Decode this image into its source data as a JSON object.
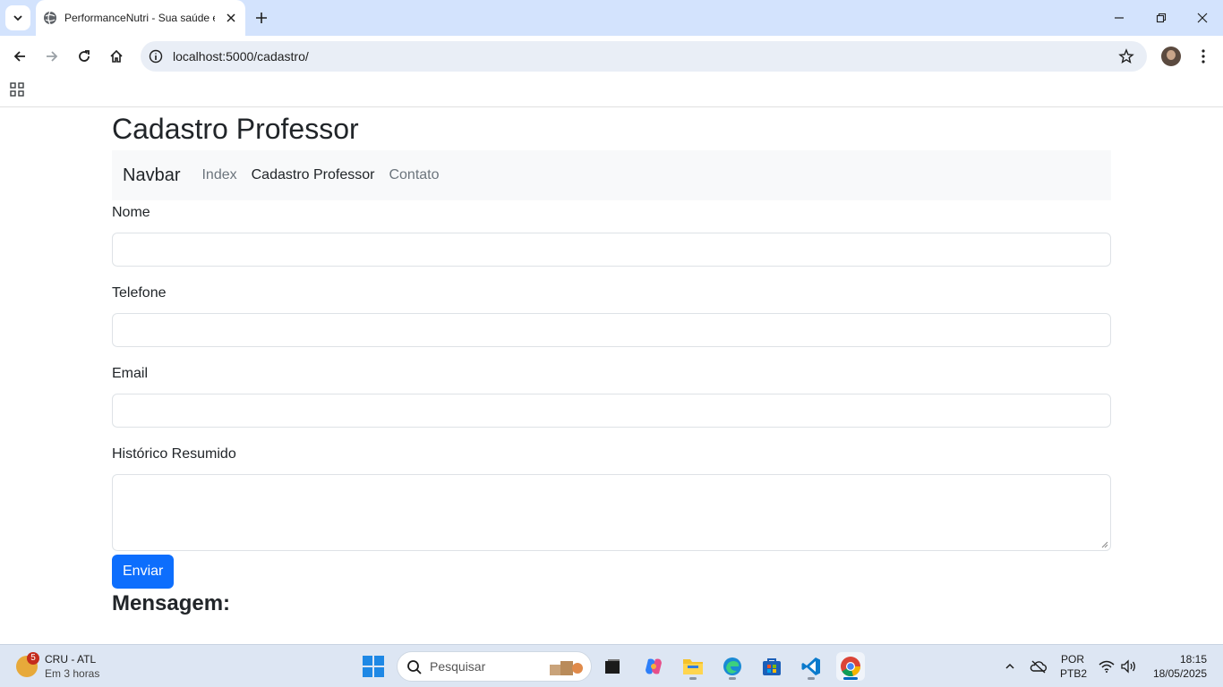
{
  "browser": {
    "tab_title": "PerformanceNutri - Sua saúde e",
    "url": "localhost:5000/cadastro/"
  },
  "page": {
    "title": "Cadastro Professor",
    "navbar": {
      "brand": "Navbar",
      "links": [
        "Index",
        "Cadastro Professor",
        "Contato"
      ],
      "active_index": 1
    },
    "form": {
      "nome_label": "Nome",
      "telefone_label": "Telefone",
      "email_label": "Email",
      "historico_label": "Histórico Resumido",
      "submit_label": "Enviar"
    },
    "message_heading": "Mensagem:"
  },
  "taskbar": {
    "weather_title": "CRU - ATL",
    "weather_sub": "Em 3 horas",
    "weather_badge": "5",
    "search_placeholder": "Pesquisar",
    "language_line1": "POR",
    "language_line2": "PTB2",
    "time": "18:15",
    "date": "18/05/2025"
  },
  "colors": {
    "primary": "#0d6efd",
    "navbar_bg": "#f8f9fa",
    "tabstrip_bg": "#d3e3fd"
  }
}
